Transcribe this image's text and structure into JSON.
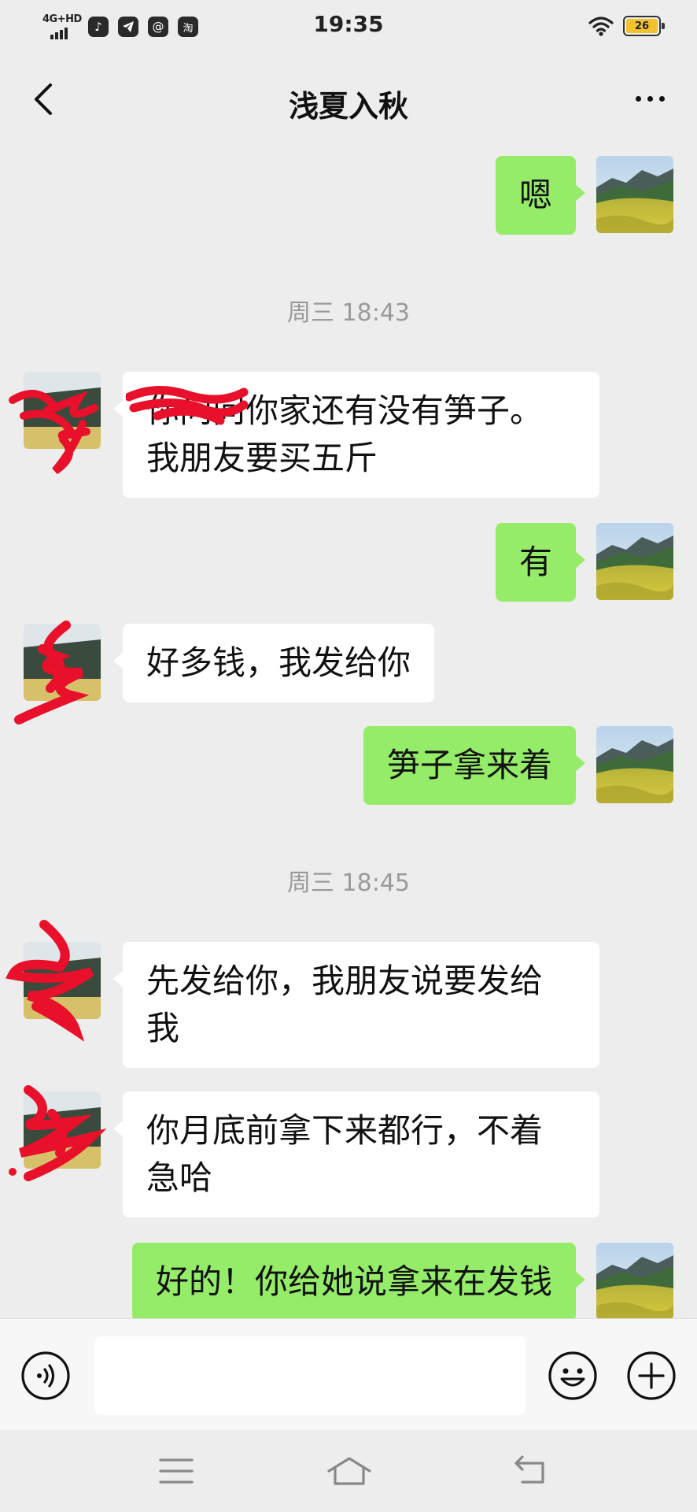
{
  "status_bar": {
    "time": "19:35",
    "network_label": "4G+HD",
    "battery_level": "26",
    "app_icons": [
      "tiktok-icon",
      "telegram-icon",
      "qq-mail-icon",
      "taobao-icon"
    ]
  },
  "header": {
    "title": "浅夏入秋"
  },
  "messages": [
    {
      "type": "text",
      "sender": "me",
      "text": "嗯"
    },
    {
      "type": "time",
      "text": "周三 18:43"
    },
    {
      "type": "text",
      "sender": "other",
      "line1": "你问问你家还有没有笋子。",
      "line2": "我朋友要买五斤"
    },
    {
      "type": "text",
      "sender": "me",
      "text": "有"
    },
    {
      "type": "text",
      "sender": "other",
      "text": "好多钱，我发给你"
    },
    {
      "type": "text",
      "sender": "me",
      "text": "笋子拿来着"
    },
    {
      "type": "time",
      "text": "周三 18:45"
    },
    {
      "type": "text",
      "sender": "other",
      "line1": "先发给你，我朋友说要发给",
      "line2": "我"
    },
    {
      "type": "text",
      "sender": "other",
      "line1": "你月底前拿下来都行，不着",
      "line2": "急哈"
    },
    {
      "type": "text",
      "sender": "me",
      "text": "好的！你给她说拿来在发钱"
    }
  ],
  "input": {
    "value": "",
    "placeholder": ""
  },
  "colors": {
    "background": "#ededed",
    "my_bubble": "#95ec69",
    "other_bubble": "#ffffff",
    "timestamp": "#9a9a9a",
    "scribble": "#e8102a"
  }
}
